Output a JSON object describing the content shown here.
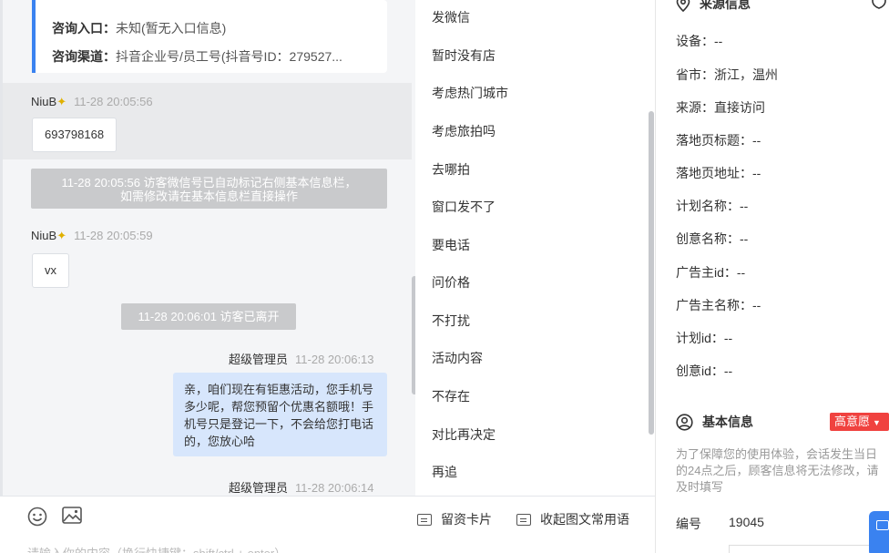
{
  "chat": {
    "info_card": {
      "entry_key": "咨询入口：",
      "entry_value": "未知(暂无入口信息)",
      "channel_key": "咨询渠道：",
      "channel_value": "抖音企业号/员工号(抖音号ID：279527..."
    },
    "messages": [
      {
        "sender": "NiuB",
        "time": "11-28 20:05:56",
        "text": "693798168"
      },
      {
        "sender": "NiuB",
        "time": "11-28 20:05:59",
        "text": "vx"
      }
    ],
    "system_notices": [
      {
        "line1": "11-28 20:05:56 访客微信号已自动标记右侧基本信息栏，",
        "line2": "如需修改请在基本信息栏直接操作"
      },
      {
        "line1": "11-28 20:06:01 访客已离开",
        "line2": ""
      }
    ],
    "agent_messages": [
      {
        "sender": "超级管理员",
        "time": "11-28 20:06:13",
        "text": "亲，咱们现在有钜惠活动，您手机号多少呢，帮您预留个优惠名额哦！手机号只是登记一下，不会给您打电话的，您放心哈"
      },
      {
        "sender": "超级管理员",
        "time": "11-28 20:06:14",
        "text": ""
      }
    ]
  },
  "quick_replies": [
    "发微信",
    "暂时没有店",
    "考虑热门城市",
    "考虑旅拍吗",
    "去哪拍",
    "窗口发不了",
    "要电话",
    "问价格",
    "不打扰",
    "活动内容",
    "不存在",
    "对比再决定",
    "再追"
  ],
  "toolbar": {
    "card_label": "留资卡片",
    "collapse_label": "收起图文常用语",
    "input_placeholder": "请输入你的内容（换行快捷键：shift/ctrl + enter）"
  },
  "panel": {
    "source_title": "来源信息",
    "source_fields": [
      "设备：--",
      "省市：浙江，温州",
      "来源：直接访问",
      "落地页标题：--",
      "落地页地址：--",
      "计划名称：--",
      "创意名称：--",
      "广告主id：--",
      "广告主名称：--",
      "计划id：--",
      "创意id：--"
    ],
    "basic_title": "基本信息",
    "intent_badge": "高意愿",
    "note": "为了保障您的使用体验，会话发生当日的24点之后，顾客信息将无法修改，请及时填写",
    "id_label": "编号",
    "id_value": "19045"
  },
  "colors": {
    "accent": "#3a82f0",
    "badge": "#f0423f",
    "agent_bubble": "#d7e6fc",
    "system_notice": "#c9cacc"
  }
}
